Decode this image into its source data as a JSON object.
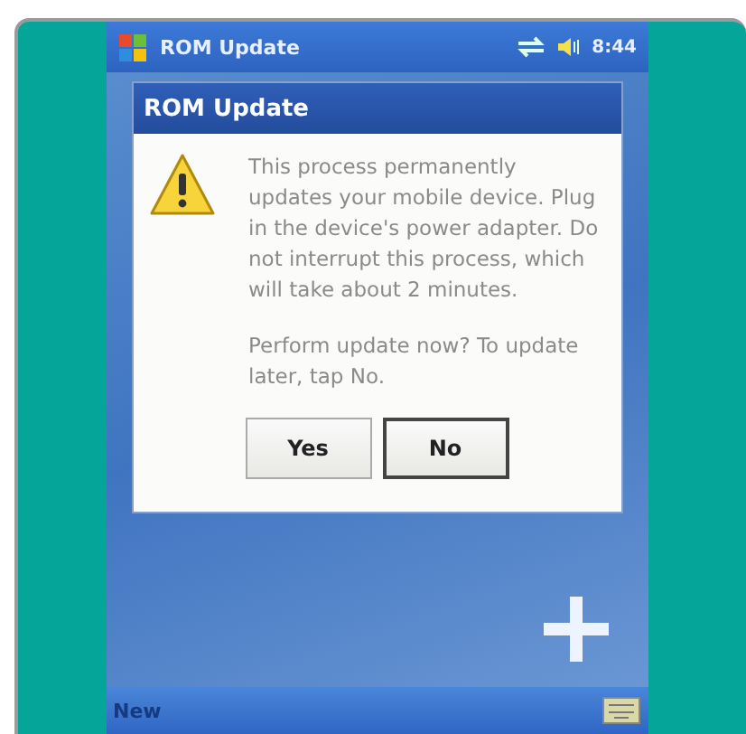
{
  "status_bar": {
    "title": "ROM Update",
    "time": "8:44"
  },
  "dialog": {
    "title": "ROM Update",
    "message": "This process permanently updates your mobile device. Plug in the device's power adapter. Do not interrupt this process, which will take about 2 minutes.",
    "prompt": "Perform update now? To update later, tap No.",
    "buttons": [
      {
        "label": "Yes",
        "selected": false
      },
      {
        "label": "No",
        "selected": true
      }
    ]
  },
  "menu_bar": {
    "left": "New"
  }
}
